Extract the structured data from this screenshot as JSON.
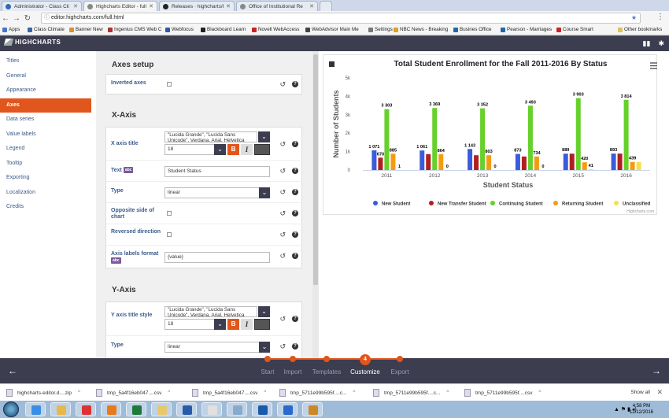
{
  "browser": {
    "tabs": [
      {
        "label": "Administrator - Class Cli",
        "color": "#2e6bb0"
      },
      {
        "label": "Highcharts Editor - full",
        "color": "#888888"
      },
      {
        "label": "Releases · highcharts/hi",
        "color": "#222222"
      },
      {
        "label": "Office of Institutional Re",
        "color": "#888888"
      }
    ],
    "url": "editor.highcharts.com/full.html",
    "bookmarks": [
      {
        "label": "Apps",
        "color": "#4477cc"
      },
      {
        "label": "Class Climate",
        "color": "#3366aa"
      },
      {
        "label": "Banner New",
        "color": "#d89030"
      },
      {
        "label": "Ingenius CMS Web C",
        "color": "#aa3333"
      },
      {
        "label": "Webfocus",
        "color": "#3355aa"
      },
      {
        "label": "Blackboard Learn",
        "color": "#222222"
      },
      {
        "label": "Novell WebAccess",
        "color": "#cc2222"
      },
      {
        "label": "WebAdvisor Main Me",
        "color": "#444444"
      },
      {
        "label": "Settings",
        "color": "#777777"
      },
      {
        "label": "NBC News - Breaking",
        "color": "#e0a020"
      },
      {
        "label": "Busines Office",
        "color": "#2266aa"
      },
      {
        "label": "Pearson - Marriages",
        "color": "#2266aa"
      },
      {
        "label": "Course Smart",
        "color": "#cc2222"
      },
      {
        "label": "Other bookmarks",
        "color": "#e0c060"
      }
    ]
  },
  "app": {
    "logo": "HIGHCHARTS"
  },
  "sidebar": {
    "items": [
      {
        "label": "Titles",
        "active": false
      },
      {
        "label": "General",
        "active": false
      },
      {
        "label": "Appearance",
        "active": false
      },
      {
        "label": "Axes",
        "active": true
      },
      {
        "label": "Data series",
        "active": false
      },
      {
        "label": "Value labels",
        "active": false
      },
      {
        "label": "Legend",
        "active": false
      },
      {
        "label": "Tooltip",
        "active": false
      },
      {
        "label": "Exporting",
        "active": false
      },
      {
        "label": "Localization",
        "active": false
      },
      {
        "label": "Credits",
        "active": false
      }
    ]
  },
  "panel": {
    "axes_setup": {
      "title": "Axes setup",
      "inverted_label": "Inverted axes"
    },
    "x_axis": {
      "title": "X-Axis",
      "title_label": "X axis title",
      "font_value": "\"Lucida Grande\", \"Lucida Sans Unicode\", Verdana, Arial, Helvetica",
      "size_value": "18",
      "text_label": "Text",
      "text_badge": "abc",
      "text_value": "Student Status",
      "type_label": "Type",
      "type_value": "linear",
      "opposite_label": "Opposite side of chart",
      "reversed_label": "Reversed direction",
      "format_label": "Axis labels format",
      "format_badge": "abc",
      "format_value": "{value}"
    },
    "y_axis": {
      "title": "Y-Axis",
      "title_style_label": "Y axis title style",
      "font_value": "\"Lucida Grande\", \"Lucida Sans Unicode\", Verdana, Arial, Helvetica",
      "size_value": "18",
      "type_label": "Type",
      "type_value": "linear"
    },
    "bold_glyph": "B",
    "italic_glyph": "I"
  },
  "chart_data": {
    "type": "bar",
    "title": "Total Student Enrollment for the Fall 2011-2016 By Status",
    "xlabel": "Student Status",
    "ylabel": "Number of Students",
    "categories": [
      "2011",
      "2012",
      "2013",
      "2014",
      "2015",
      "2016"
    ],
    "ylim": [
      0,
      5000
    ],
    "yticks": [
      "0",
      "1k",
      "2k",
      "3k",
      "4k",
      "5k"
    ],
    "series": [
      {
        "name": "New Student",
        "color": "#3b5bdb",
        "values": [
          1071,
          1061,
          1143,
          873,
          889,
          893
        ],
        "labels": [
          "1 071",
          "1 061",
          "1 143",
          "873",
          "889",
          "893"
        ]
      },
      {
        "name": "New Transfer Student",
        "color": "#b0201e",
        "values": [
          670,
          864,
          803,
          734,
          889,
          893
        ],
        "labels": [
          "670",
          "",
          "",
          "",
          "",
          ""
        ]
      },
      {
        "name": "Continuing Student",
        "color": "#66d12a",
        "values": [
          3303,
          3369,
          3352,
          3493,
          3903,
          3814
        ],
        "labels": [
          "3 303",
          "3 369",
          "3 352",
          "3 493",
          "3 903",
          "3 814"
        ]
      },
      {
        "name": "Returning Student",
        "color": "#f39c12",
        "values": [
          885,
          864,
          803,
          734,
          420,
          439
        ],
        "labels": [
          "885",
          "864",
          "803",
          "734",
          "420",
          "439"
        ]
      },
      {
        "name": "Unclassified",
        "color": "#f4e04d",
        "values": [
          1,
          0,
          0,
          0,
          41,
          439
        ],
        "labels": [
          "1",
          "0",
          "0",
          "0",
          "41",
          ""
        ]
      }
    ],
    "legend_position": "bottom",
    "credits": "Highcharts.com",
    "grid": false
  },
  "wizard": {
    "steps": [
      {
        "label": "Start",
        "current": false
      },
      {
        "label": "Import",
        "current": false
      },
      {
        "label": "Templates",
        "current": false
      },
      {
        "label": "Customize",
        "current": true,
        "number": "4"
      },
      {
        "label": "Export",
        "current": false
      }
    ]
  },
  "downloads": {
    "items": [
      {
        "label": "highcharts-editor.d....zip"
      },
      {
        "label": "tmp_5a4f16eb047....csv"
      },
      {
        "label": "tmp_5a4f16eb047....csv"
      },
      {
        "label": "tmp_5711e99b595f....c..."
      },
      {
        "label": "tmp_5711e99b595f....c..."
      },
      {
        "label": "tmp_5711e99b595f....csv"
      }
    ],
    "show_all": "Show all"
  },
  "taskbar": {
    "time": "4:58 PM",
    "date": "12/12/2016",
    "apps": [
      {
        "name": "ie-icon",
        "color": "#3a8ee6"
      },
      {
        "name": "explorer-icon",
        "color": "#e8b84a"
      },
      {
        "name": "chrome-icon",
        "color": "#d33"
      },
      {
        "name": "media-icon",
        "color": "#e87a1a"
      },
      {
        "name": "excel-icon",
        "color": "#1e7a3a"
      },
      {
        "name": "folder-icon",
        "color": "#e8c86a"
      },
      {
        "name": "word-icon",
        "color": "#2a5aaa"
      },
      {
        "name": "paint-icon",
        "color": "#e0e0e0"
      },
      {
        "name": "settings-icon",
        "color": "#88aacc"
      },
      {
        "name": "outlook-icon",
        "color": "#1a5aaa"
      },
      {
        "name": "lync-icon",
        "color": "#2a6acc"
      },
      {
        "name": "network-icon",
        "color": "#cc8822"
      }
    ]
  }
}
